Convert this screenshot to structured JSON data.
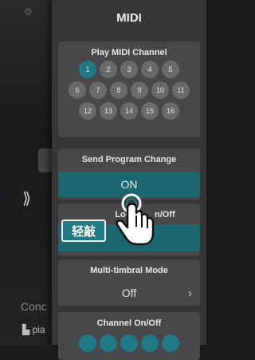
{
  "background": {
    "left_bottom_label": "Conc",
    "left_bottom_label2": "pia",
    "collapse_arrow": "⟫"
  },
  "panel": {
    "title": "MIDI",
    "play_midi_channel": {
      "title": "Play MIDI Channel",
      "selected": 1,
      "channels": [
        "1",
        "2",
        "3",
        "4",
        "5",
        "6",
        "7",
        "8",
        "9",
        "10",
        "11",
        "12",
        "13",
        "14",
        "15",
        "16"
      ]
    },
    "send_program_change": {
      "title": "Send Program Change",
      "value": "ON"
    },
    "local_on_off": {
      "title": "Local On/Off",
      "title_visible": "Loca       n/Off"
    },
    "multi_timbral_mode": {
      "title": "Multi-timbral Mode",
      "value": "Off"
    },
    "channel_on_off": {
      "title": "Channel On/Off"
    }
  },
  "overlay": {
    "tap_label": "轻敲"
  },
  "colors": {
    "accent": "#1f7a86",
    "panel_bg": "#363638",
    "card_bg": "#48484a"
  }
}
